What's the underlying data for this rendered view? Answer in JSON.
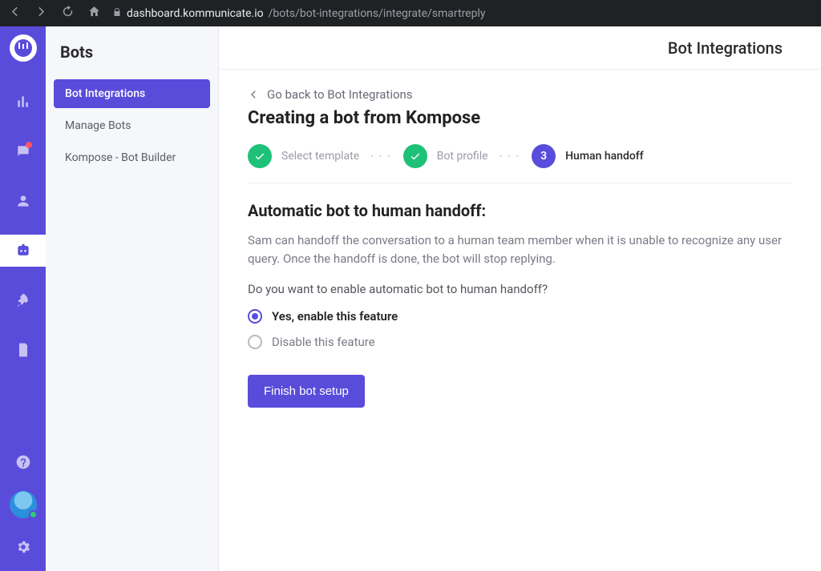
{
  "browser": {
    "host": "dashboard.kommunicate.io",
    "path": "/bots/bot-integrations/integrate/smartreply"
  },
  "rail": {
    "items": [
      {
        "id": "analytics",
        "icon": "analytics-icon"
      },
      {
        "id": "conversations",
        "icon": "chat-icon",
        "badge": true
      },
      {
        "id": "users",
        "icon": "user-icon"
      },
      {
        "id": "bots",
        "icon": "bot-icon",
        "active": true
      },
      {
        "id": "launch",
        "icon": "rocket-icon"
      },
      {
        "id": "docs",
        "icon": "doc-icon"
      }
    ]
  },
  "sidebar": {
    "title": "Bots",
    "items": [
      {
        "label": "Bot Integrations",
        "active": true
      },
      {
        "label": "Manage Bots",
        "active": false
      },
      {
        "label": "Kompose - Bot Builder",
        "active": false
      }
    ]
  },
  "header": {
    "title": "Bot Integrations"
  },
  "back_link": "Go back to Bot Integrations",
  "page_title": "Creating a bot from Kompose",
  "steps": [
    {
      "label": "Select template",
      "state": "done"
    },
    {
      "label": "Bot profile",
      "state": "done"
    },
    {
      "label": "Human handoff",
      "state": "current",
      "number": "3"
    }
  ],
  "section": {
    "title": "Automatic bot to human handoff:",
    "desc": "Sam can handoff the conversation to a human team member when it is unable to recognize any user query. Once the handoff is done, the bot will stop replying.",
    "question": "Do you want to enable automatic bot to human handoff?",
    "options": [
      {
        "label": "Yes, enable this feature",
        "selected": true
      },
      {
        "label": "Disable this feature",
        "selected": false
      }
    ],
    "submit_label": "Finish bot setup"
  }
}
